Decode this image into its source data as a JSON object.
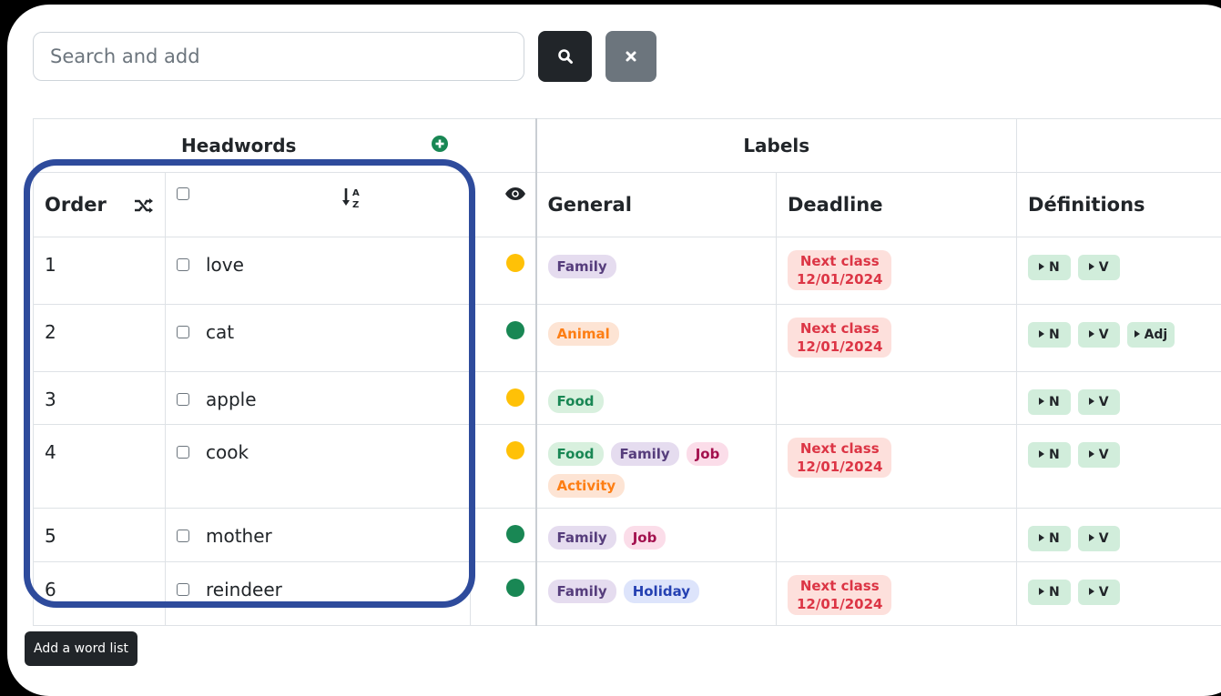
{
  "search": {
    "placeholder": "Search and add"
  },
  "buttons": {
    "add_list": "Add a word list"
  },
  "headers": {
    "headwords": "Headwords",
    "labels": "Labels",
    "order": "Order",
    "general": "General",
    "deadline": "Deadline",
    "definitions": "Définitions"
  },
  "rows": [
    {
      "order": "1",
      "word": "love",
      "status": "yellow",
      "general": [
        "Family"
      ],
      "deadline": [
        "Next class",
        "12/01/2024"
      ],
      "defs": [
        "N",
        "V"
      ]
    },
    {
      "order": "2",
      "word": "cat",
      "status": "green",
      "general": [
        "Animal"
      ],
      "deadline": [
        "Next class",
        "12/01/2024"
      ],
      "defs": [
        "N",
        "V",
        "Adj"
      ]
    },
    {
      "order": "3",
      "word": "apple",
      "status": "yellow",
      "general": [
        "Food"
      ],
      "deadline": null,
      "defs": [
        "N",
        "V"
      ]
    },
    {
      "order": "4",
      "word": "cook",
      "status": "yellow",
      "general": [
        "Food",
        "Family",
        "Job",
        "Activity"
      ],
      "deadline": [
        "Next class",
        "12/01/2024"
      ],
      "defs": [
        "N",
        "V"
      ]
    },
    {
      "order": "5",
      "word": "mother",
      "status": "green",
      "general": [
        "Family",
        "Job"
      ],
      "deadline": null,
      "defs": [
        "N",
        "V"
      ]
    },
    {
      "order": "6",
      "word": "reindeer",
      "status": "green",
      "general": [
        "Family",
        "Holiday"
      ],
      "deadline": [
        "Next class",
        "12/01/2024"
      ],
      "defs": [
        "N",
        "V"
      ]
    }
  ],
  "colors": {
    "status_yellow": "#ffc107",
    "status_green": "#198754",
    "highlight": "#2e4b9c"
  },
  "icons": {
    "search": "search-icon",
    "clear": "close-icon",
    "add_headword": "plus-circle-icon",
    "shuffle": "shuffle-icon",
    "sort": "sort-alpha-icon",
    "visibility": "eye-icon"
  }
}
